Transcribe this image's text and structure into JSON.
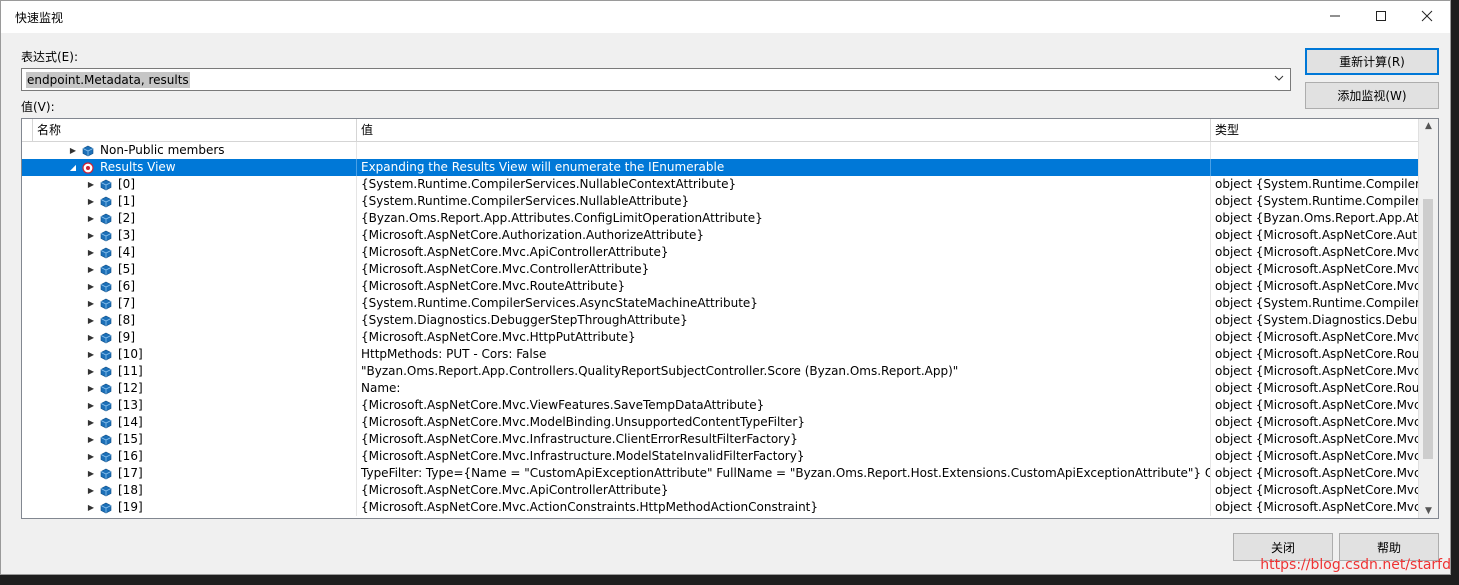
{
  "window": {
    "title": "快速监视"
  },
  "expression": {
    "label": "表达式(E):",
    "value": "endpoint.Metadata, results"
  },
  "value_label": "值(V):",
  "buttons": {
    "recalculate": "重新计算(R)",
    "add_watch": "添加监视(W)",
    "close": "关闭",
    "help": "帮助"
  },
  "grid": {
    "columns": [
      "名称",
      "值",
      "类型"
    ],
    "rows": [
      {
        "name": "Non-Public members",
        "value": "",
        "type": ""
      },
      {
        "name": "Results View",
        "value": "Expanding the Results View will enumerate the IEnumerable",
        "type": ""
      },
      {
        "name": "[0]",
        "value": "{System.Runtime.CompilerServices.NullableContextAttribute}",
        "type": "object {System.Runtime.CompilerSer..."
      },
      {
        "name": "[1]",
        "value": "{System.Runtime.CompilerServices.NullableAttribute}",
        "type": "object {System.Runtime.CompilerSer..."
      },
      {
        "name": "[2]",
        "value": "{Byzan.Oms.Report.App.Attributes.ConfigLimitOperationAttribute}",
        "type": "object {Byzan.Oms.Report.App.Attrib..."
      },
      {
        "name": "[3]",
        "value": "{Microsoft.AspNetCore.Authorization.AuthorizeAttribute}",
        "type": "object {Microsoft.AspNetCore.Autho..."
      },
      {
        "name": "[4]",
        "value": "{Microsoft.AspNetCore.Mvc.ApiControllerAttribute}",
        "type": "object {Microsoft.AspNetCore.Mvc.A..."
      },
      {
        "name": "[5]",
        "value": "{Microsoft.AspNetCore.Mvc.ControllerAttribute}",
        "type": "object {Microsoft.AspNetCore.Mvc.C..."
      },
      {
        "name": "[6]",
        "value": "{Microsoft.AspNetCore.Mvc.RouteAttribute}",
        "type": "object {Microsoft.AspNetCore.Mvc.R..."
      },
      {
        "name": "[7]",
        "value": "{System.Runtime.CompilerServices.AsyncStateMachineAttribute}",
        "type": "object {System.Runtime.CompilerSer..."
      },
      {
        "name": "[8]",
        "value": "{System.Diagnostics.DebuggerStepThroughAttribute}",
        "type": "object {System.Diagnostics.Debugge..."
      },
      {
        "name": "[9]",
        "value": "{Microsoft.AspNetCore.Mvc.HttpPutAttribute}",
        "type": "object {Microsoft.AspNetCore.Mvc.H..."
      },
      {
        "name": "[10]",
        "value": "HttpMethods: PUT - Cors: False",
        "type": "object {Microsoft.AspNetCore.Routin..."
      },
      {
        "name": "[11]",
        "value": "\"Byzan.Oms.Report.App.Controllers.QualityReportSubjectController.Score (Byzan.Oms.Report.App)\"",
        "type": "object {Microsoft.AspNetCore.Mvc.C..."
      },
      {
        "name": "[12]",
        "value": "Name:",
        "type": "object {Microsoft.AspNetCore.Routin..."
      },
      {
        "name": "[13]",
        "value": "{Microsoft.AspNetCore.Mvc.ViewFeatures.SaveTempDataAttribute}",
        "type": "object {Microsoft.AspNetCore.Mvc.V..."
      },
      {
        "name": "[14]",
        "value": "{Microsoft.AspNetCore.Mvc.ModelBinding.UnsupportedContentTypeFilter}",
        "type": "object {Microsoft.AspNetCore.Mvc...."
      },
      {
        "name": "[15]",
        "value": "{Microsoft.AspNetCore.Mvc.Infrastructure.ClientErrorResultFilterFactory}",
        "type": "object {Microsoft.AspNetCore.Mvc.I..."
      },
      {
        "name": "[16]",
        "value": "{Microsoft.AspNetCore.Mvc.Infrastructure.ModelStateInvalidFilterFactory}",
        "type": "object {Microsoft.AspNetCore.Mvc.I..."
      },
      {
        "name": "[17]",
        "value": "TypeFilter: Type={Name = \"CustomApiExceptionAttribute\" FullName = \"Byzan.Oms.Report.Host.Extensions.CustomApiExceptionAttribute\"} Order=0",
        "type": "object {Microsoft.AspNetCore.Mvc.T..."
      },
      {
        "name": "[18]",
        "value": "{Microsoft.AspNetCore.Mvc.ApiControllerAttribute}",
        "type": "object {Microsoft.AspNetCore.Mvc.A..."
      },
      {
        "name": "[19]",
        "value": "{Microsoft.AspNetCore.Mvc.ActionConstraints.HttpMethodActionConstraint}",
        "type": "object {Microsoft.AspNetCore.Mvc.A..."
      }
    ]
  },
  "watermark": "https://blog.csdn.net/starfd",
  "colors": {
    "selection": "#0078d7",
    "accent": "#0078d7"
  }
}
